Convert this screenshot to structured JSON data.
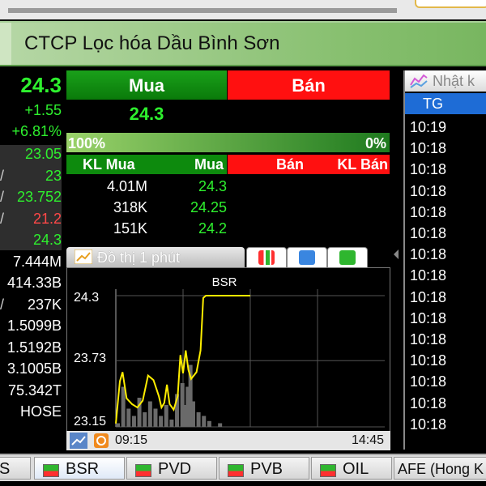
{
  "title": "CTCP Lọc hóa Dầu Bình Sơn",
  "left_stats": {
    "price": "24.3",
    "change": "+1.55",
    "change_pct": "+6.81%",
    "rows": [
      {
        "prefix": "",
        "value": "23.05",
        "color": "#2ef02e"
      },
      {
        "prefix": "/",
        "value": "23",
        "color": "#2ef02e"
      },
      {
        "prefix": "/",
        "value": "23.752",
        "color": "#2ef02e"
      },
      {
        "prefix": "/",
        "value": "21.2",
        "color": "#ff4848"
      },
      {
        "prefix": "",
        "value": "24.3",
        "color": "#2ef02e"
      },
      {
        "prefix": "",
        "value": "7.444M",
        "color": "#ffffff"
      },
      {
        "prefix": "",
        "value": "414.33B",
        "color": "#ffffff"
      },
      {
        "prefix": "/",
        "value": "237K",
        "color": "#ffffff"
      },
      {
        "prefix": "",
        "value": "1.5099B",
        "color": "#ffffff"
      },
      {
        "prefix": "",
        "value": "1.5192B",
        "color": "#ffffff"
      },
      {
        "prefix": "",
        "value": "3.1005B",
        "color": "#ffffff"
      },
      {
        "prefix": "",
        "value": "75.342T",
        "color": "#ffffff"
      },
      {
        "prefix": "",
        "value": "HOSE",
        "color": "#ffffff"
      }
    ]
  },
  "order_book": {
    "buy_label": "Mua",
    "sell_label": "Bán",
    "buy_price": "24.3",
    "buy_ratio": "100%",
    "sell_ratio": "0%",
    "col_buy_vol": "KL Mua",
    "col_buy_price": "Mua",
    "col_sell_price": "Bán",
    "col_sell_vol": "KL Bán",
    "rows": [
      {
        "vol": "4.01M",
        "price": "24.3"
      },
      {
        "vol": "318K",
        "price": "24.25"
      },
      {
        "vol": "151K",
        "price": "24.2"
      }
    ]
  },
  "chart_tabs": {
    "active_label": "Đồ thị 1 phút"
  },
  "chart_data": {
    "type": "line",
    "title": "BSR",
    "x_start_label": "09:15",
    "x_end_label": "14:45",
    "ylim": [
      23.15,
      24.3
    ],
    "y_ticks": [
      "24.3",
      "23.73",
      "23.15"
    ],
    "price_series": [
      {
        "x": 0.0,
        "y": 23.18
      },
      {
        "x": 0.015,
        "y": 23.55
      },
      {
        "x": 0.025,
        "y": 23.63
      },
      {
        "x": 0.04,
        "y": 23.4
      },
      {
        "x": 0.06,
        "y": 23.35
      },
      {
        "x": 0.08,
        "y": 23.32
      },
      {
        "x": 0.1,
        "y": 23.38
      },
      {
        "x": 0.12,
        "y": 23.6
      },
      {
        "x": 0.14,
        "y": 23.56
      },
      {
        "x": 0.16,
        "y": 23.42
      },
      {
        "x": 0.17,
        "y": 23.32
      },
      {
        "x": 0.18,
        "y": 23.36
      },
      {
        "x": 0.19,
        "y": 23.52
      },
      {
        "x": 0.2,
        "y": 23.35
      },
      {
        "x": 0.215,
        "y": 23.3
      },
      {
        "x": 0.23,
        "y": 23.42
      },
      {
        "x": 0.24,
        "y": 23.78
      },
      {
        "x": 0.25,
        "y": 23.62
      },
      {
        "x": 0.26,
        "y": 23.82
      },
      {
        "x": 0.27,
        "y": 23.65
      },
      {
        "x": 0.28,
        "y": 23.57
      },
      {
        "x": 0.3,
        "y": 23.63
      },
      {
        "x": 0.315,
        "y": 23.82
      },
      {
        "x": 0.325,
        "y": 24.28
      },
      {
        "x": 0.335,
        "y": 24.3
      },
      {
        "x": 0.5,
        "y": 24.3
      }
    ],
    "volume_series": [
      {
        "x": 0.0,
        "v": 0.05
      },
      {
        "x": 0.02,
        "v": 0.55
      },
      {
        "x": 0.04,
        "v": 0.25
      },
      {
        "x": 0.06,
        "v": 0.15
      },
      {
        "x": 0.08,
        "v": 0.4
      },
      {
        "x": 0.1,
        "v": 0.2
      },
      {
        "x": 0.12,
        "v": 0.35
      },
      {
        "x": 0.14,
        "v": 0.25
      },
      {
        "x": 0.16,
        "v": 0.15
      },
      {
        "x": 0.18,
        "v": 0.3
      },
      {
        "x": 0.2,
        "v": 0.1
      },
      {
        "x": 0.22,
        "v": 0.45
      },
      {
        "x": 0.24,
        "v": 0.6
      },
      {
        "x": 0.25,
        "v": 0.3
      },
      {
        "x": 0.26,
        "v": 0.55
      },
      {
        "x": 0.27,
        "v": 0.85
      },
      {
        "x": 0.28,
        "v": 0.35
      },
      {
        "x": 0.3,
        "v": 0.2
      },
      {
        "x": 0.32,
        "v": 0.15
      },
      {
        "x": 0.34,
        "v": 0.08
      },
      {
        "x": 0.38,
        "v": 0.05
      }
    ]
  },
  "time_panel": {
    "header_label": "Nhật k",
    "col_label": "TG",
    "times": [
      "10:19",
      "10:18",
      "10:18",
      "10:18",
      "10:18",
      "10:18",
      "10:18",
      "10:18",
      "10:18",
      "10:18",
      "10:18",
      "10:18",
      "10:18",
      "10:18",
      "10:18"
    ]
  },
  "bottom_tabs": [
    "S",
    "BSR",
    "PVD",
    "PVB",
    "OIL",
    "AFE (Hong K"
  ],
  "colors": {
    "green": "#2ef02e",
    "red": "#ff1010",
    "blue": "#1e6cd6",
    "yellow": "#ffe800"
  }
}
